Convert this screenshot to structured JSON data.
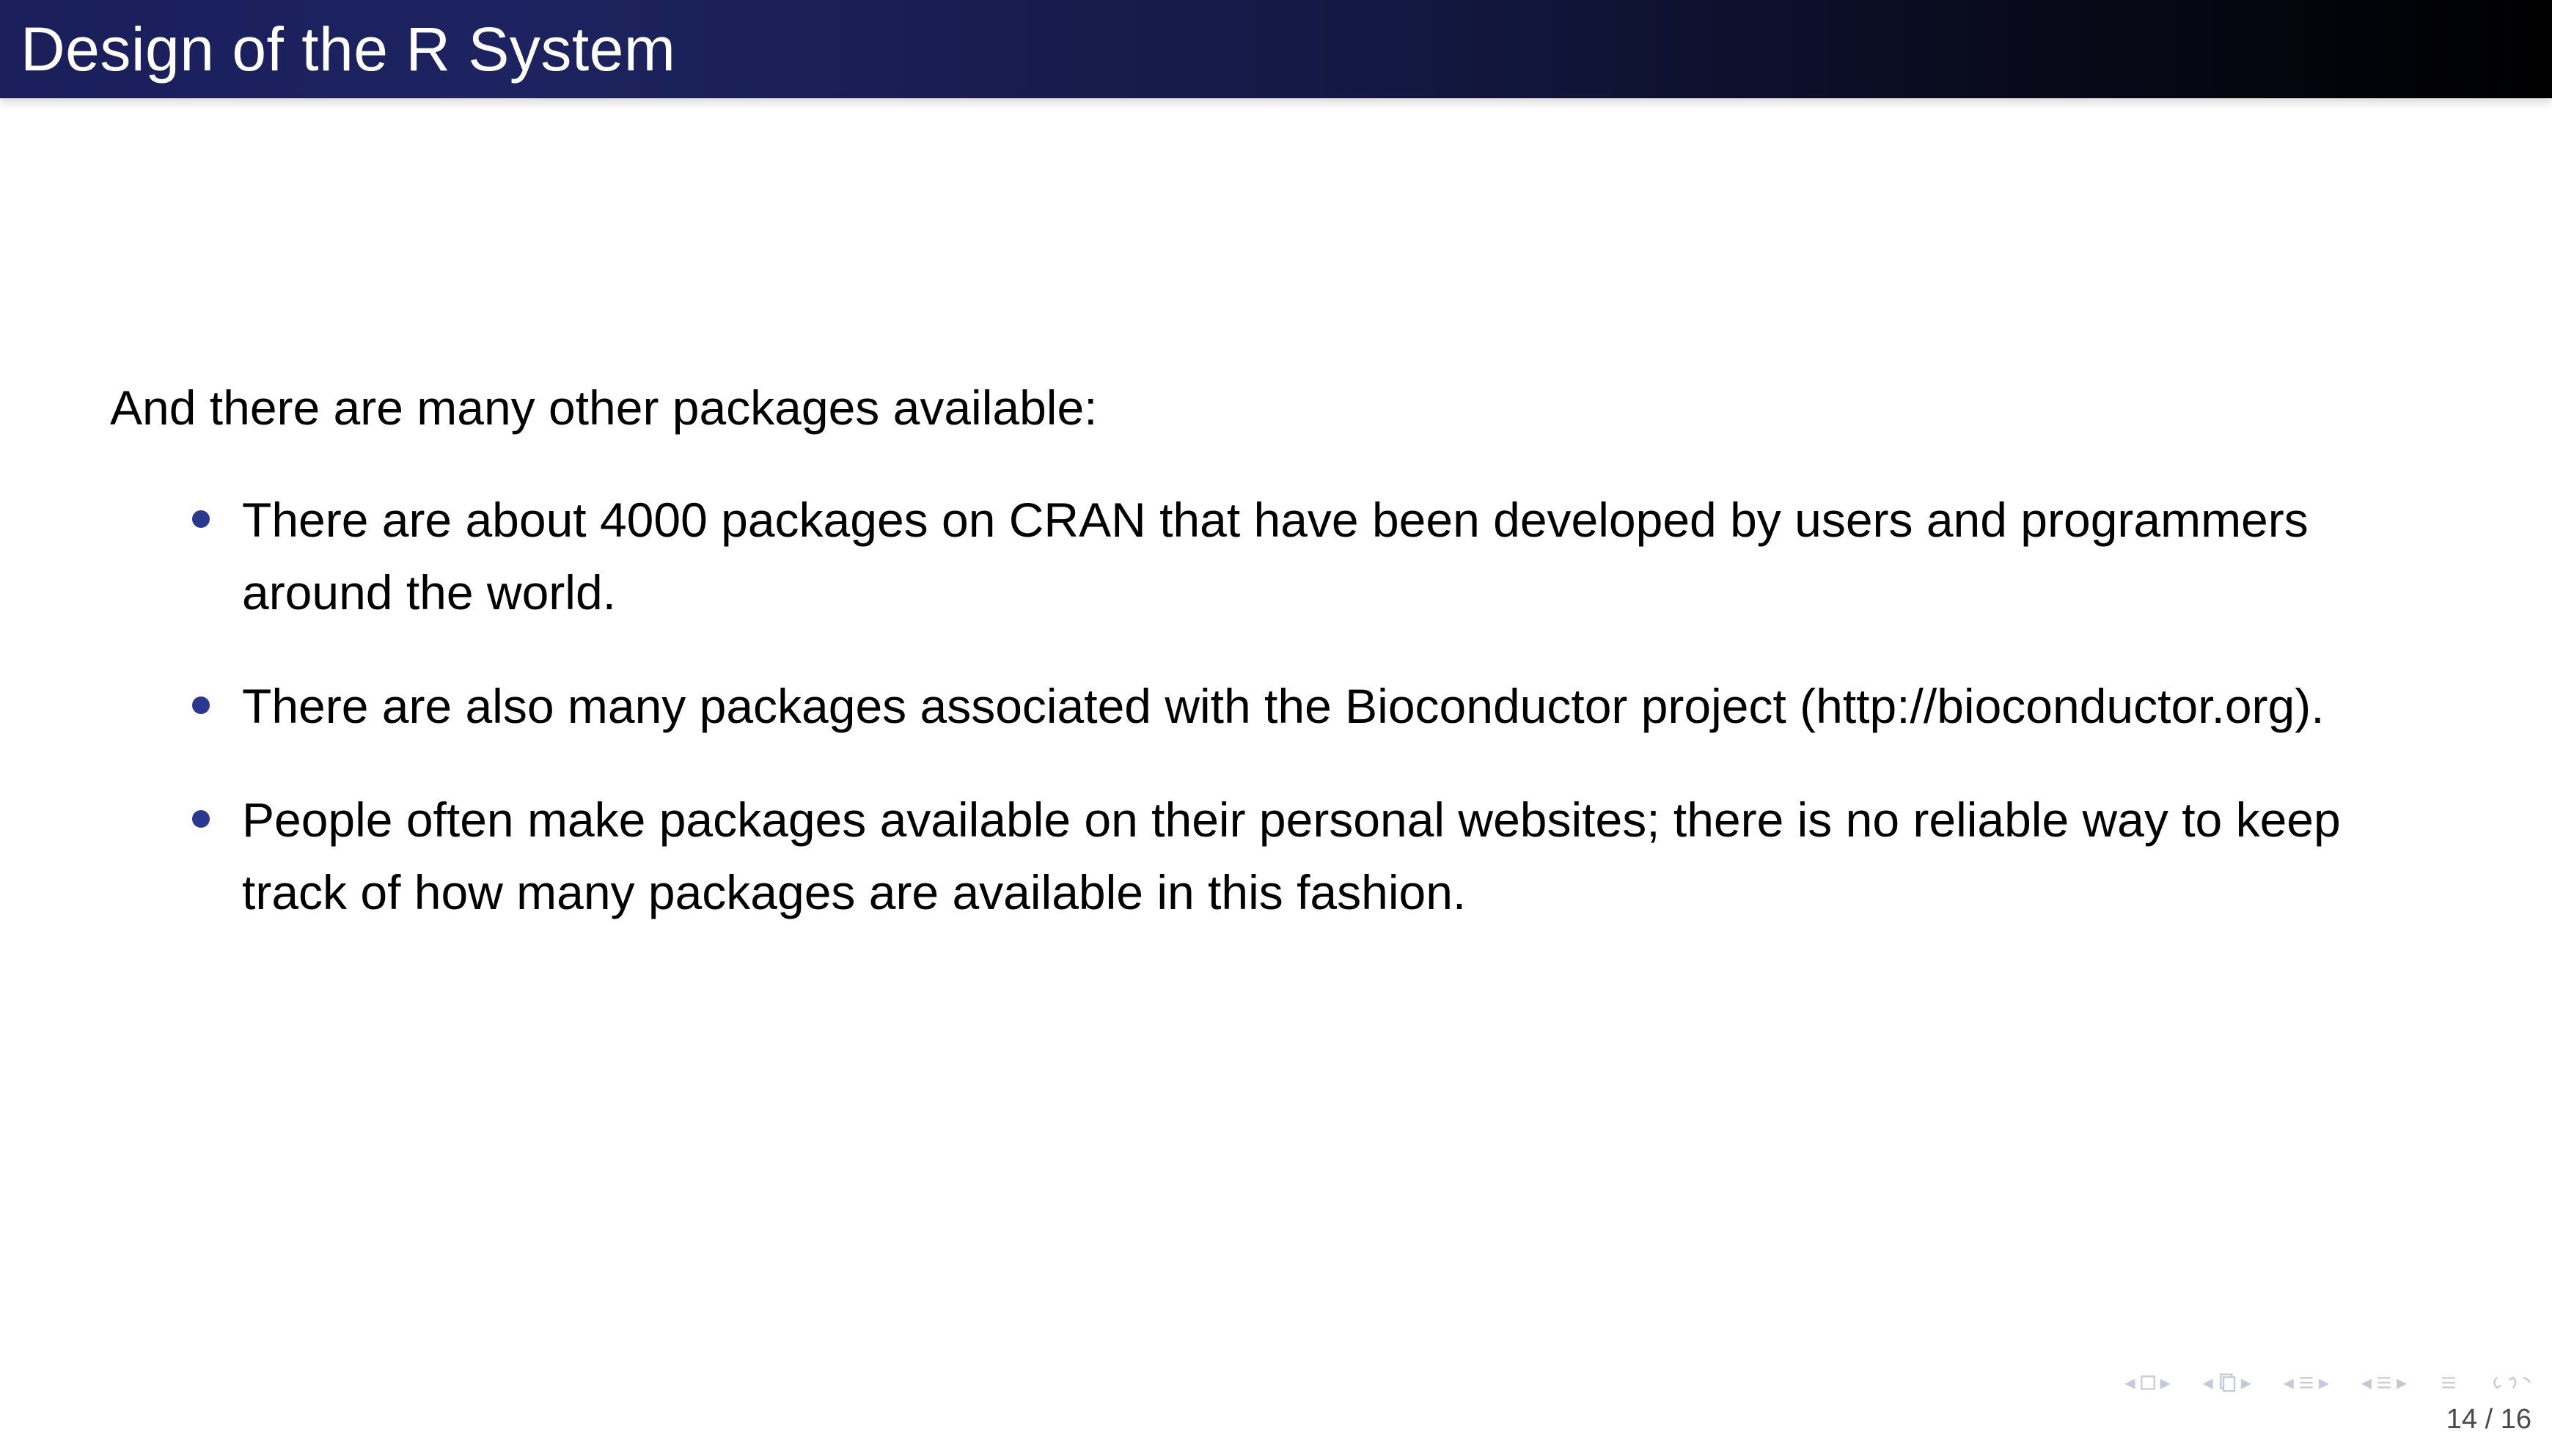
{
  "slide": {
    "title": "Design of the R System",
    "intro": "And there are many other packages available:",
    "bullets": [
      "There are about 4000 packages on CRAN that have been developed by users and programmers around the world.",
      "There are also many packages associated with the Bioconductor project (http://bioconductor.org).",
      "People often make packages available on their personal websites; there is no reliable way to keep track of how many packages are available in this fashion."
    ],
    "page_current": 14,
    "page_total": 16,
    "page_display": "14 / 16"
  }
}
